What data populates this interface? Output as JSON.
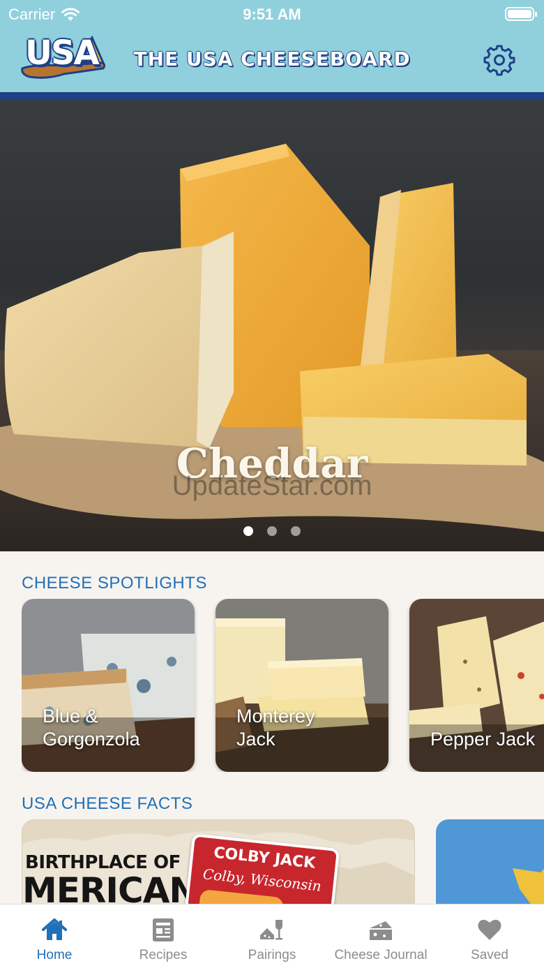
{
  "status": {
    "carrier": "Carrier",
    "time": "9:51 AM"
  },
  "header": {
    "logo_text": "USA",
    "title": "THE USA CHEESEBOARD",
    "settings_icon": "gear-icon"
  },
  "hero": {
    "title": "Cheddar",
    "watermark": "UpdateStar.com",
    "page_count": 3,
    "active_page": 1
  },
  "spotlights": {
    "heading": "CHEESE SPOTLIGHTS",
    "cards": [
      {
        "line1": "Blue &",
        "line2": "Gorgonzola"
      },
      {
        "line1": "Monterey",
        "line2": "Jack"
      },
      {
        "line1": "",
        "line2": "Pepper Jack"
      }
    ]
  },
  "facts": {
    "heading": "USA CHEESE FACTS",
    "cards": [
      {
        "birthplace": "BIRTHPLACE OF",
        "big": "MERICAN",
        "badge_title": "COLBY JACK",
        "badge_subtitle": "Colby, Wisconsin"
      },
      {}
    ]
  },
  "tabs": [
    {
      "label": "Home",
      "icon": "home-icon",
      "active": true
    },
    {
      "label": "Recipes",
      "icon": "recipe-icon",
      "active": false
    },
    {
      "label": "Pairings",
      "icon": "pairings-icon",
      "active": false
    },
    {
      "label": "Cheese Journal",
      "icon": "journal-icon",
      "active": false
    },
    {
      "label": "Saved",
      "icon": "heart-icon",
      "active": false
    }
  ],
  "colors": {
    "header_bg": "#8fd0dc",
    "header_rule": "#1f3f86",
    "accent": "#2170b8",
    "tab_inactive": "#8c8c8c"
  }
}
